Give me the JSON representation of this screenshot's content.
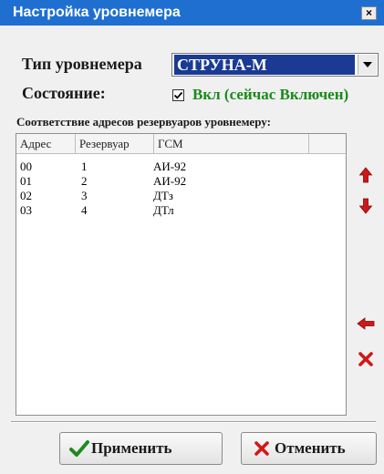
{
  "window": {
    "title": "Настройка уровнемера",
    "close_label": "×"
  },
  "form": {
    "type_label": "Тип уровнемера",
    "type_value": "СТРУНА-М",
    "state_label": "Состояние:",
    "state_checked": true,
    "state_text": "Вкл (сейчас Включен)",
    "state_color": "#1b8a1b"
  },
  "mapping": {
    "title": "Соответствие адресов резервуаров уровнемеру:",
    "columns": [
      "Адрес",
      "Резервуар",
      "ГСМ",
      ""
    ],
    "rows": [
      [
        "00",
        "1",
        "АИ-92"
      ],
      [
        "01",
        "2",
        "АИ-92"
      ],
      [
        "02",
        "3",
        "ДТз"
      ],
      [
        "03",
        "4",
        "ДТл"
      ]
    ]
  },
  "side_buttons": [
    "arrow-up-icon",
    "arrow-down-icon",
    "arrow-left-icon",
    "delete-icon"
  ],
  "actions": {
    "apply_label": "Применить",
    "cancel_label": "Отменить"
  },
  "colors": {
    "titlebar": "#1f6fd0",
    "selection": "#1a3a93",
    "apply_icon": "#1e8a1e",
    "cancel_icon": "#d01818",
    "side_icon": "#d01818"
  }
}
